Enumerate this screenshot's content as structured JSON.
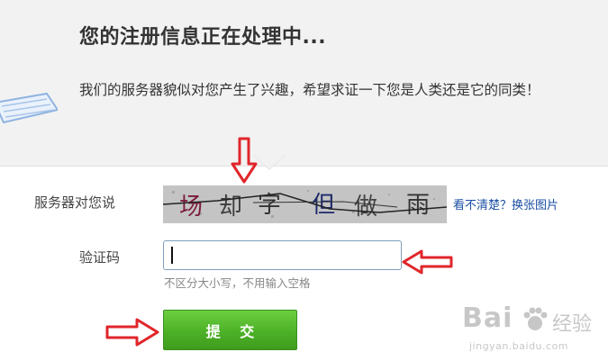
{
  "header": {
    "title": "您的注册信息正在处理中...",
    "subtitle": "我们的服务器貌似对您产生了兴趣，希望求证一下您是人类还是它的同类！"
  },
  "form": {
    "server_label": "服务器对您说",
    "captcha_chars": [
      "场",
      "却",
      "字",
      "但",
      "做",
      "雨"
    ],
    "refresh_link": "看不清楚？换张图片",
    "code_label": "验证码",
    "code_value": "",
    "hint": "不区分大小写，不用输入空格",
    "submit_label": "提 交"
  },
  "watermark": {
    "logo": "Bai",
    "logo_suffix": "经验",
    "url": "jingyan.baidu.com"
  },
  "colors": {
    "panel_bg": "#f2f2f2",
    "link": "#1a4fa3",
    "button_green": "#4db128",
    "annotation_red": "#e0262b"
  }
}
